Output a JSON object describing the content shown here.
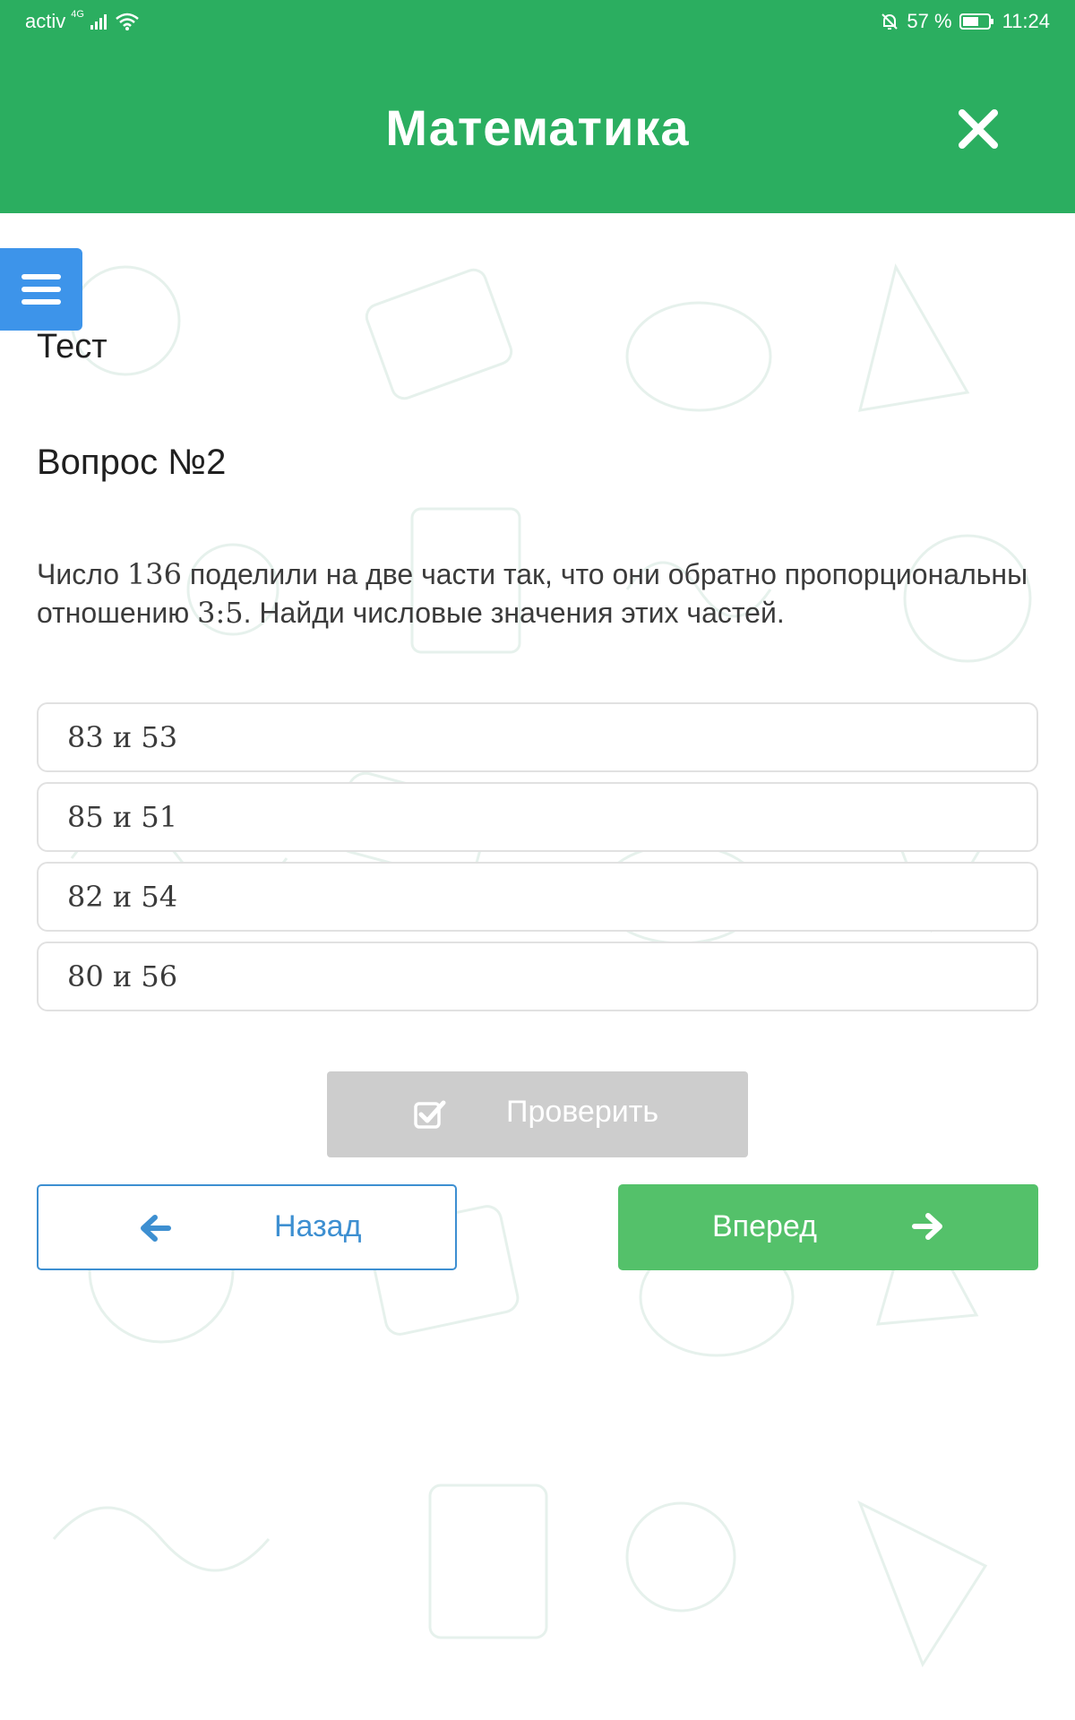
{
  "status_bar": {
    "carrier": "activ",
    "network": "4G",
    "battery": "57 %",
    "time": "11:24"
  },
  "header": {
    "title": "Математика",
    "close_icon": "close-icon"
  },
  "menu": {
    "icon": "hamburger-icon"
  },
  "section_label": "Тест",
  "question": {
    "title": "Вопрос №2",
    "text_part1": "Число ",
    "text_num1": "136",
    "text_part2": " поделили на две части так, что они обратно пропорциональны отношению ",
    "text_num2": "3:5",
    "text_part3": ". Найди числовые значения этих частей."
  },
  "options": [
    "83 и 53",
    "85 и 51",
    "82 и 54",
    "80 и 56"
  ],
  "buttons": {
    "check_label": "Проверить",
    "back_label": "Назад",
    "next_label": "Вперед"
  },
  "colors": {
    "header": "#2bae60",
    "menu_button": "#3d94ea",
    "back_button_border": "#3d8fd1",
    "next_button": "#54c16a",
    "check_button_disabled": "#cdcdcd"
  }
}
